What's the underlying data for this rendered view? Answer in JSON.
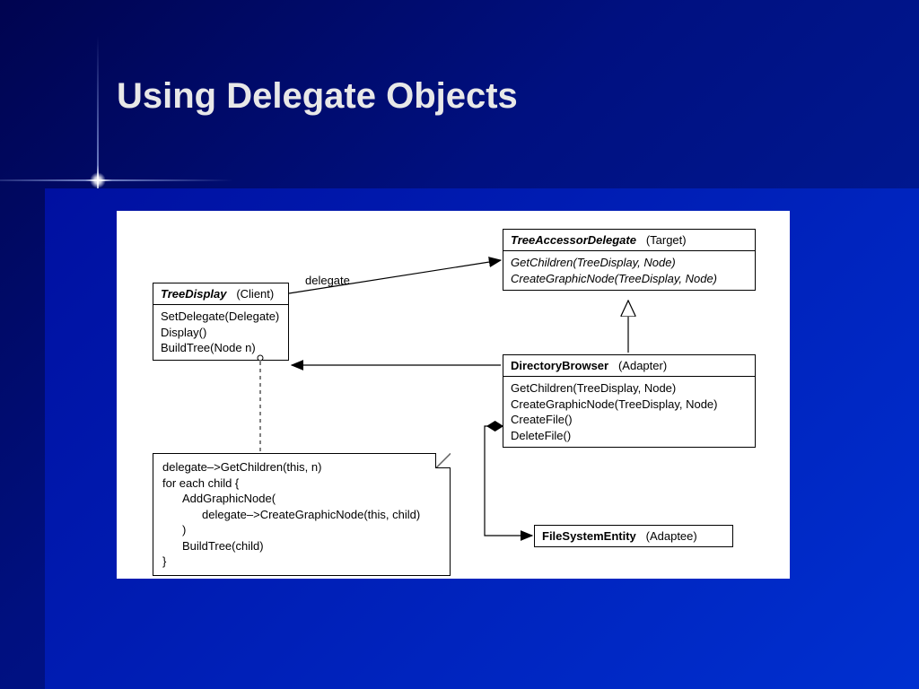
{
  "title": "Using Delegate Objects",
  "delegateLabel": "delegate",
  "treeDisplay": {
    "name": "TreeDisplay",
    "role": "(Client)",
    "ops": [
      "SetDelegate(Delegate)",
      "Display()",
      "BuildTree(Node n)"
    ]
  },
  "treeAccessor": {
    "name": "TreeAccessorDelegate",
    "role": "(Target)",
    "ops": [
      "GetChildren(TreeDisplay, Node)",
      "CreateGraphicNode(TreeDisplay, Node)"
    ]
  },
  "directoryBrowser": {
    "name": "DirectoryBrowser",
    "role": "(Adapter)",
    "ops": [
      "GetChildren(TreeDisplay, Node)",
      "CreateGraphicNode(TreeDisplay, Node)",
      "CreateFile()",
      "DeleteFile()"
    ]
  },
  "fileSystemEntity": {
    "name": "FileSystemEntity",
    "role": "(Adaptee)"
  },
  "note": {
    "l1": "delegate–>GetChildren(this, n)",
    "l2": "for each child {",
    "l3": "AddGraphicNode(",
    "l4": "delegate–>CreateGraphicNode(this, child)",
    "l5": ")",
    "l6": "BuildTree(child)",
    "l7": "}"
  }
}
